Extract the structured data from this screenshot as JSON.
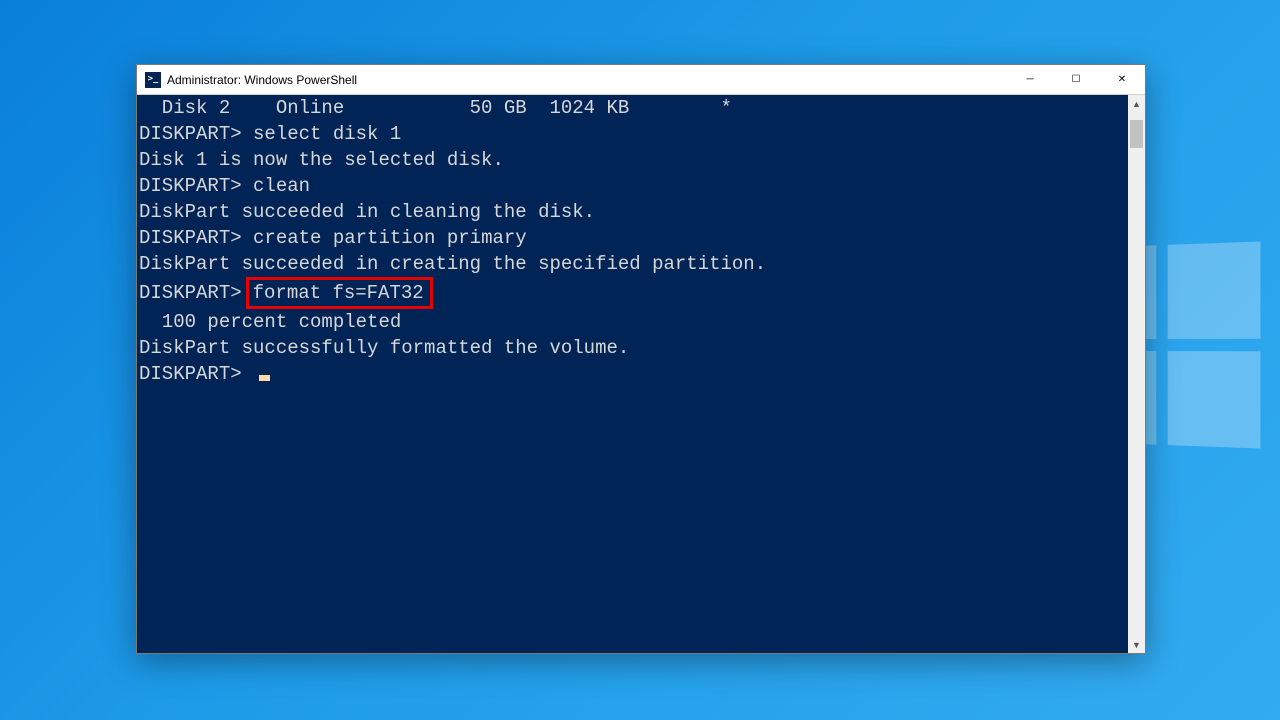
{
  "window": {
    "title": "Administrator: Windows PowerShell",
    "icon_label": ">_"
  },
  "controls": {
    "minimize": "─",
    "maximize": "☐",
    "close": "✕"
  },
  "scrollbar": {
    "up": "▲",
    "down": "▼"
  },
  "terminal": {
    "lines": {
      "l0": "  Disk 2    Online           50 GB  1024 KB        *",
      "l1": "",
      "l2p": "DISKPART>",
      "l2c": "select disk 1",
      "l3": "",
      "l4": "Disk 1 is now the selected disk.",
      "l5": "",
      "l6p": "DISKPART>",
      "l6c": "clean",
      "l7": "",
      "l8": "DiskPart succeeded in cleaning the disk.",
      "l9": "",
      "l10p": "DISKPART>",
      "l10c": "create partition primary",
      "l11": "",
      "l12": "DiskPart succeeded in creating the specified partition.",
      "l13": "",
      "l14p": "DISKPART>",
      "l14h": "format fs=FAT32",
      "l15": "",
      "l16": "  100 percent completed",
      "l17": "",
      "l18": "DiskPart successfully formatted the volume.",
      "l19": "",
      "l20p": "DISKPART> "
    }
  }
}
